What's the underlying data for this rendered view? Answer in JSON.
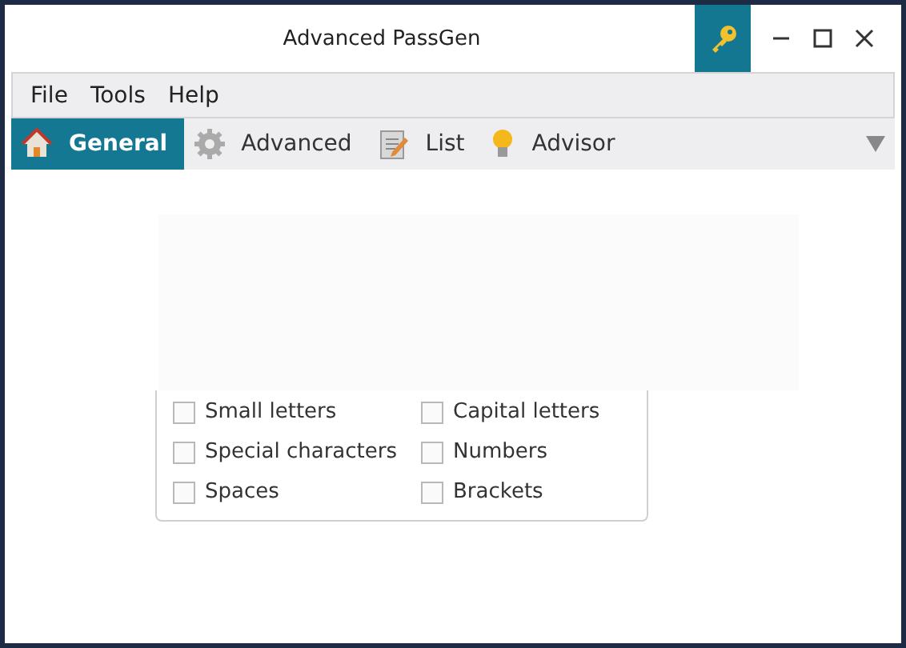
{
  "window": {
    "title": "Advanced PassGen"
  },
  "menu": [
    {
      "label": "File"
    },
    {
      "label": "Tools"
    },
    {
      "label": "Help"
    }
  ],
  "tabs": [
    {
      "label": "General",
      "selected": true
    },
    {
      "label": "Advanced",
      "selected": false
    },
    {
      "label": "List",
      "selected": false
    },
    {
      "label": "Advisor",
      "selected": false
    }
  ],
  "options": [
    {
      "label": "Small letters",
      "checked": false
    },
    {
      "label": "Capital letters",
      "checked": false
    },
    {
      "label": "Special characters",
      "checked": false
    },
    {
      "label": "Numbers",
      "checked": false
    },
    {
      "label": "Spaces",
      "checked": false
    },
    {
      "label": "Brackets",
      "checked": false
    }
  ]
}
